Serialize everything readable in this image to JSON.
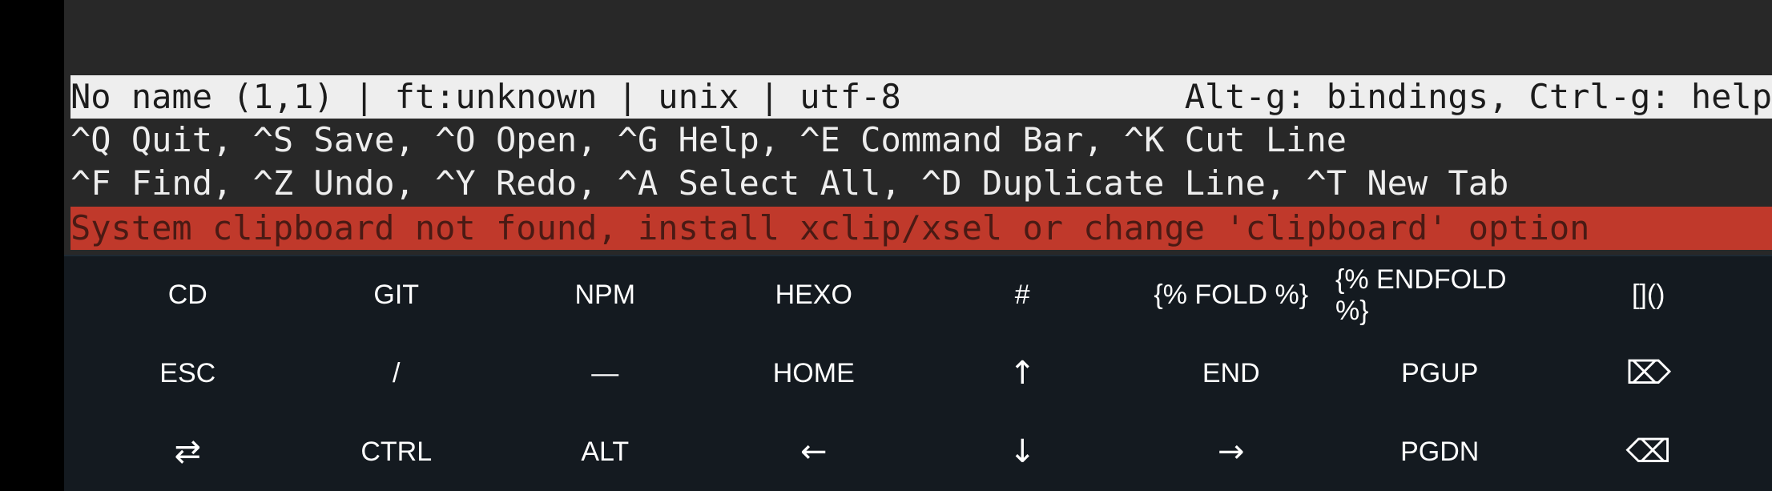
{
  "editor": {
    "status_left": "No name (1,1) | ft:unknown | unix | utf-8",
    "status_right": "Alt-g: bindings, Ctrl-g: help",
    "help_line_1": "^Q Quit, ^S Save, ^O Open, ^G Help, ^E Command Bar, ^K Cut Line",
    "help_line_2": "^F Find, ^Z Undo, ^Y Redo, ^A Select All, ^D Duplicate Line, ^T New Tab",
    "message": "System clipboard not found, install xclip/xsel or change 'clipboard' option"
  },
  "colors": {
    "terminal_bg": "#282828",
    "status_bg": "#eeeeee",
    "message_bg": "#c0392b",
    "keys_bg": "#141a20"
  },
  "extra_keys": {
    "row1": [
      "CD",
      "GIT",
      "NPM",
      "HEXO",
      "#",
      "{% FOLD %}",
      "{% ENDFOLD %}",
      "[]()"
    ],
    "row2": [
      "ESC",
      "/",
      "—",
      "HOME",
      "↑",
      "END",
      "PGUP",
      "⌦"
    ],
    "row3": [
      "⇄",
      "CTRL",
      "ALT",
      "←",
      "↓",
      "→",
      "PGDN",
      "⌫"
    ]
  }
}
